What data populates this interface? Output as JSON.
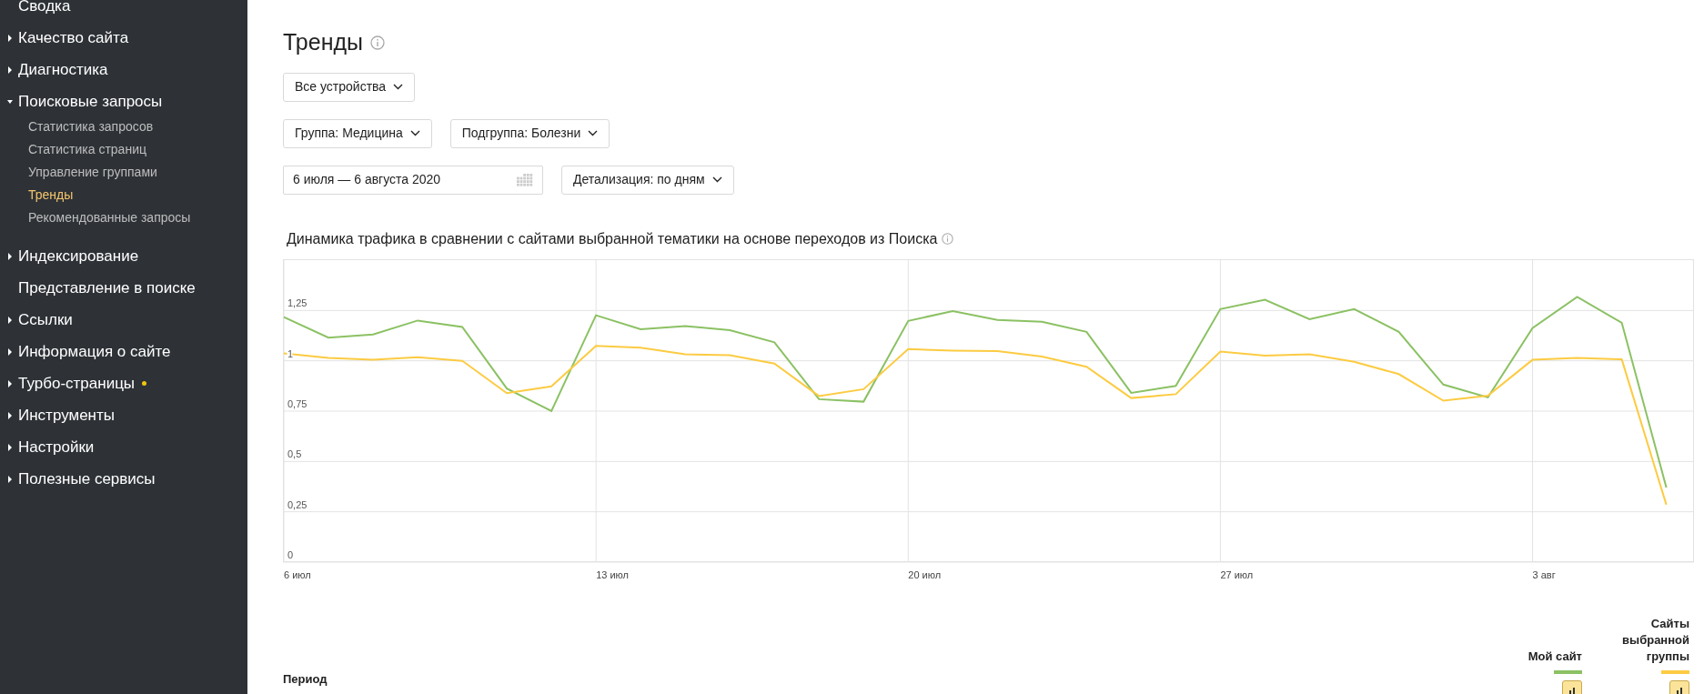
{
  "sidebar": {
    "items": [
      {
        "label": "Сводка"
      },
      {
        "label": "Качество сайта",
        "expanded": false
      },
      {
        "label": "Диагностика",
        "expanded": false
      },
      {
        "label": "Поисковые запросы",
        "expanded": true,
        "children": [
          {
            "label": "Статистика запросов",
            "selected": false
          },
          {
            "label": "Статистика страниц",
            "selected": false
          },
          {
            "label": "Управление группами",
            "selected": false
          },
          {
            "label": "Тренды",
            "selected": true
          },
          {
            "label": "Рекомендованные запросы",
            "selected": false
          }
        ]
      },
      {
        "label": "Индексирование",
        "expanded": false
      },
      {
        "label": "Представление в поиске"
      },
      {
        "label": "Ссылки",
        "expanded": false
      },
      {
        "label": "Информация о сайте",
        "expanded": false
      },
      {
        "label": "Турбо-страницы",
        "expanded": false,
        "dot": true
      },
      {
        "label": "Инструменты",
        "expanded": false
      },
      {
        "label": "Настройки",
        "expanded": false
      },
      {
        "label": "Полезные сервисы",
        "expanded": false
      }
    ]
  },
  "page": {
    "title": "Тренды",
    "device_select": "Все устройства",
    "group_select": "Группа: Медицина",
    "subgroup_select": "Подгруппа: Болезни",
    "date_range": "6 июля — 6 августа 2020",
    "detail_select": "Детализация: по дням"
  },
  "chart": {
    "title": "Динамика трафика в сравнении с сайтами выбранной тематики на основе переходов из Поиска",
    "chart_data": {
      "type": "line",
      "categories": [
        "6 июл",
        null,
        null,
        null,
        null,
        null,
        null,
        "13 июл",
        null,
        null,
        null,
        null,
        null,
        null,
        "20 июл",
        null,
        null,
        null,
        null,
        null,
        null,
        "27 июл",
        null,
        null,
        null,
        null,
        null,
        null,
        "3 авг",
        null,
        null,
        null
      ],
      "series": [
        {
          "color": "#8bc163",
          "values": [
            1.217,
            1.115,
            1.131,
            1.2,
            1.168,
            0.862,
            0.751,
            1.226,
            1.157,
            1.173,
            1.152,
            1.092,
            0.809,
            0.797,
            1.198,
            1.247,
            1.203,
            1.194,
            1.144,
            0.841,
            0.875,
            1.257,
            1.303,
            1.207,
            1.257,
            1.144,
            0.882,
            0.818,
            1.162,
            1.317,
            1.189,
            0.371
          ]
        },
        {
          "color": "#fccb42",
          "values": [
            1.037,
            1.014,
            1.005,
            1.018,
            1.0,
            0.839,
            0.873,
            1.074,
            1.065,
            1.032,
            1.028,
            0.986,
            0.825,
            0.859,
            1.058,
            1.051,
            1.048,
            1.021,
            0.97,
            0.815,
            0.834,
            1.046,
            1.025,
            1.032,
            0.995,
            0.934,
            0.802,
            0.827,
            1.005,
            1.014,
            1.007,
            0.285
          ]
        }
      ],
      "ylim": [
        0,
        1.5
      ],
      "grid": true,
      "yticks": [
        {
          "value": 0,
          "label": "0"
        },
        {
          "value": 0.25,
          "label": "0,25"
        },
        {
          "value": 0.5,
          "label": "0,5"
        },
        {
          "value": 0.75,
          "label": "0,75"
        },
        {
          "value": 1,
          "label": "1"
        },
        {
          "value": 1.25,
          "label": "1,25"
        }
      ]
    }
  },
  "table": {
    "columns": [
      {
        "label": "Период"
      },
      {
        "label": "Мой сайт",
        "color": "#8bc163"
      },
      {
        "label": "Сайты выбранной группы",
        "color": "#fccb42"
      }
    ]
  }
}
